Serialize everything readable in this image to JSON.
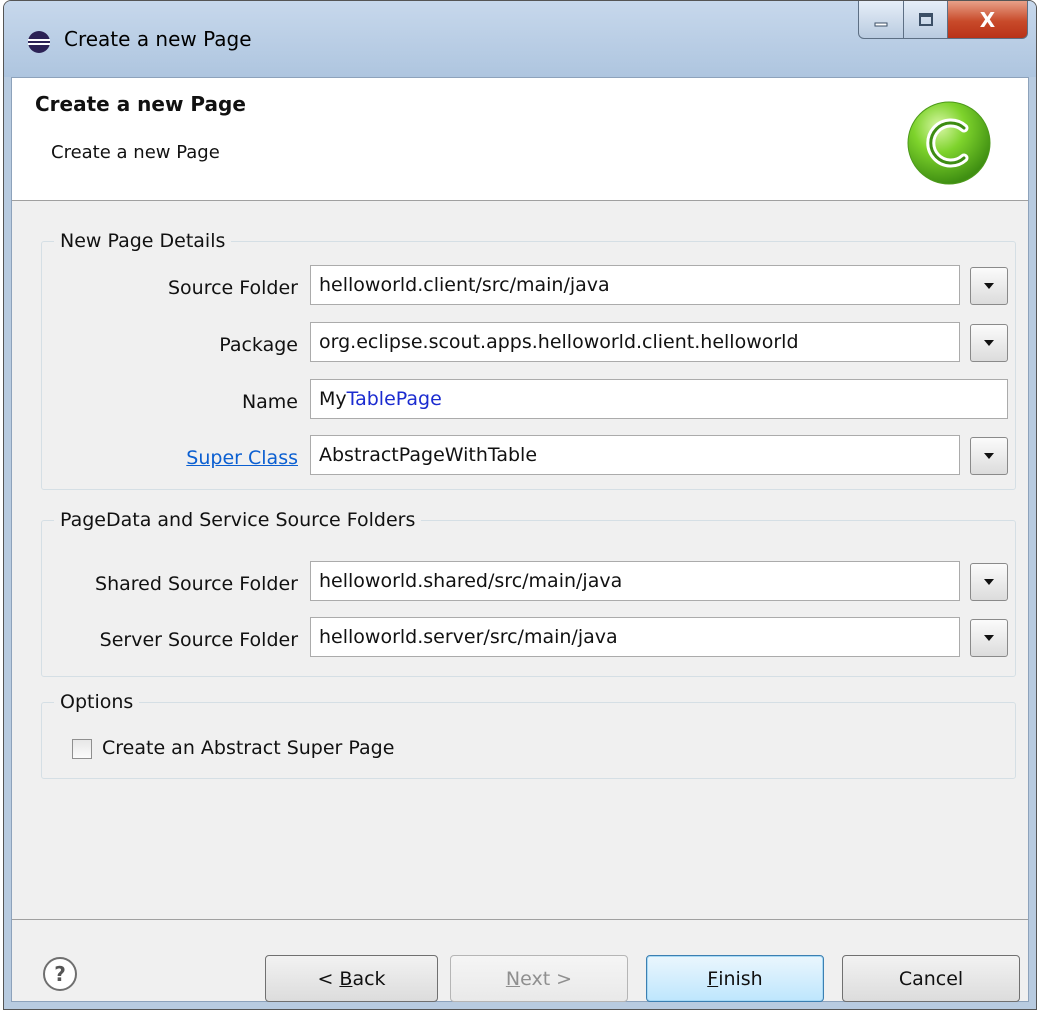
{
  "window": {
    "title": "Create a new Page",
    "close_glyph": "X"
  },
  "header": {
    "title": "Create a new Page",
    "description": "Create a new Page",
    "logo": "scout-c-logo-icon"
  },
  "details": {
    "legend": "New Page Details",
    "source_folder": {
      "label": "Source Folder",
      "value": "helloworld.client/src/main/java"
    },
    "package": {
      "label": "Package",
      "value": "org.eclipse.scout.apps.helloworld.client.helloworld"
    },
    "name": {
      "label": "Name",
      "value_prefix": "My",
      "value_suffix": "TablePage"
    },
    "super_class": {
      "label": "Super Class",
      "value": "AbstractPageWithTable"
    }
  },
  "folders": {
    "legend": "PageData and Service Source Folders",
    "shared": {
      "label": "Shared Source Folder",
      "value": "helloworld.shared/src/main/java"
    },
    "server": {
      "label": "Server Source Folder",
      "value": "helloworld.server/src/main/java"
    }
  },
  "options": {
    "legend": "Options",
    "abstract_super": {
      "label": "Create an Abstract Super Page",
      "checked": false
    }
  },
  "buttons": {
    "back": {
      "prefix": "< ",
      "mnemonic": "B",
      "rest": "ack"
    },
    "next": {
      "mnemonic": "N",
      "rest": "ext >"
    },
    "finish": {
      "mnemonic": "F",
      "rest": "inish"
    },
    "cancel": "Cancel",
    "help_glyph": "?"
  },
  "colors": {
    "accent": "#3c7fb1",
    "link": "#0b5fd1",
    "name_highlight": "#1b2bd0",
    "logo_green": "#5fbf1f"
  }
}
